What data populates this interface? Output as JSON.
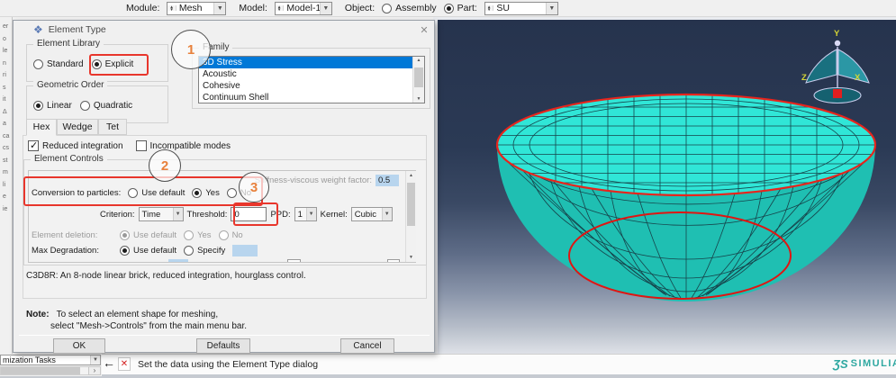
{
  "toolbar": {
    "module_label": "Module:",
    "module_value": "Mesh",
    "model_label": "Model:",
    "model_value": "Model-1",
    "object_label": "Object:",
    "assembly_label": "Assembly",
    "part_label": "Part:",
    "part_value": "SU"
  },
  "sidebar_sliver": "er\no\nle\nn\nri\ns\nit\nΔ\na\nca\ncs\nst\nm\nli\ne\nie",
  "dialog": {
    "title": "Element Type",
    "element_library": {
      "legend": "Element Library",
      "options": [
        "Standard",
        "Explicit"
      ]
    },
    "geometric_order": {
      "legend": "Geometric Order",
      "options": [
        "Linear",
        "Quadratic"
      ]
    },
    "family": {
      "legend": "Family",
      "items": [
        "3D Stress",
        "Acoustic",
        "Cohesive",
        "Continuum Shell"
      ]
    },
    "tabs": [
      "Hex",
      "Wedge",
      "Tet"
    ],
    "reduced_integration_label": "Reduced integration",
    "incompatible_modes_label": "Incompatible modes",
    "element_controls": {
      "legend": "Element Controls",
      "stiffness_label": "Stiffness-viscous weight factor:",
      "stiffness_value": "0.5",
      "conversion_label": "Conversion to particles:",
      "conversion_options": [
        "Use default",
        "Yes",
        "No"
      ],
      "criterion_label": "Criterion:",
      "criterion_value": "Time",
      "threshold_label": "Threshold:",
      "threshold_value": "0",
      "ppd_label": "PPD:",
      "ppd_value": "1",
      "kernel_label": "Kernel:",
      "kernel_value": "Cubic",
      "deletion_label": "Element deletion:",
      "deletion_options": [
        "Use default",
        "Yes",
        "No"
      ],
      "degradation_label": "Max Degradation:",
      "degradation_options": [
        "Use default",
        "Specify"
      ]
    },
    "description": "C3D8R:  An 8-node linear brick, reduced integration, hourglass control.",
    "note_label": "Note:",
    "note_line1": "To select an element shape for meshing,",
    "note_line2": "select \"Mesh->Controls\" from the main menu bar.",
    "buttons": {
      "ok": "OK",
      "defaults": "Defaults",
      "cancel": "Cancel"
    }
  },
  "callouts": {
    "one": "1",
    "two": "2",
    "three": "3"
  },
  "tree_footer": {
    "value": "mization Tasks"
  },
  "status_bar": {
    "message": "Set the data using the Element Type dialog"
  },
  "viewport": {
    "triad": {
      "x": "X",
      "y": "Y",
      "z": "Z"
    },
    "logo_mark": "ƷS",
    "logo_text": "SIMULIA"
  },
  "colors": {
    "selection_blue": "#0078d7",
    "mesh_top": "#30e6d7",
    "mesh_side": "#1fbfb2",
    "mesh_edge": "#17424a",
    "highlight_red": "#e8241c",
    "field_blue": "#b8d5ee",
    "callout_orange": "#e8813c",
    "logo_teal": "#2fa8a1",
    "viewport_top": "#293850"
  }
}
